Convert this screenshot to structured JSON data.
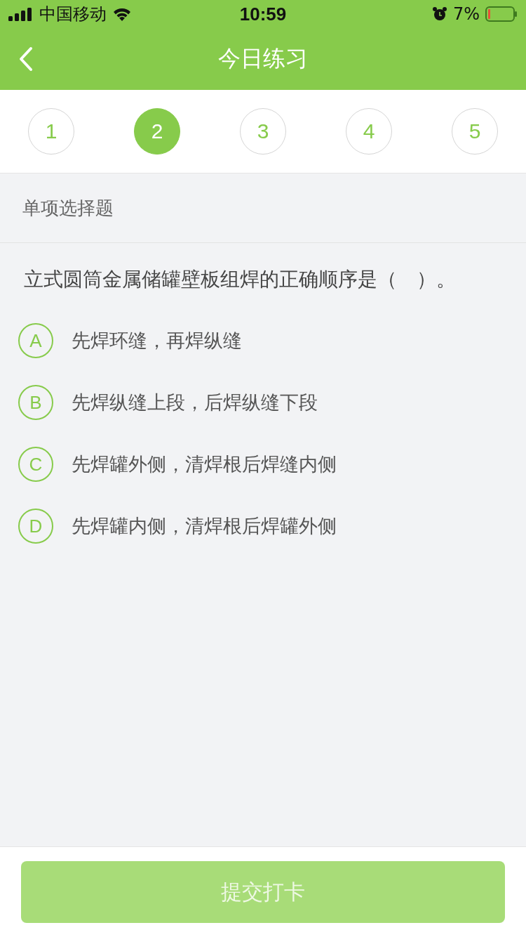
{
  "status_bar": {
    "carrier": "中国移动",
    "time": "10:59",
    "battery_percent": "7%"
  },
  "nav": {
    "title": "今日练习"
  },
  "steps": [
    {
      "label": "1",
      "selected": false
    },
    {
      "label": "2",
      "selected": true
    },
    {
      "label": "3",
      "selected": false
    },
    {
      "label": "4",
      "selected": false
    },
    {
      "label": "5",
      "selected": false
    }
  ],
  "question_type": "单项选择题",
  "question": "立式圆筒金属储罐壁板组焊的正确顺序是（　）。",
  "options": [
    {
      "letter": "A",
      "text": "先焊环缝，再焊纵缝",
      "selected": false
    },
    {
      "letter": "B",
      "text": "先焊纵缝上段，后焊纵缝下段",
      "selected": false
    },
    {
      "letter": "C",
      "text": "先焊罐外侧，清焊根后焊缝内侧",
      "selected": false
    },
    {
      "letter": "D",
      "text": "先焊罐内侧，清焊根后焊罐外侧",
      "selected": false
    }
  ],
  "submit_button": {
    "label": "提交打卡",
    "disabled": true
  }
}
